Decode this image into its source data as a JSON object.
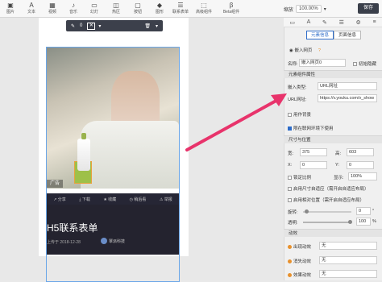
{
  "toolbar": {
    "items": [
      {
        "label": "图片",
        "icon": "image-icon",
        "glyph": "▣"
      },
      {
        "label": "文本",
        "icon": "text-icon",
        "glyph": "A"
      },
      {
        "label": "视频",
        "icon": "video-icon",
        "glyph": "▦"
      },
      {
        "label": "音乐",
        "icon": "music-icon",
        "glyph": "♪"
      },
      {
        "label": "幻灯",
        "icon": "slides-icon",
        "glyph": "▭"
      },
      {
        "label": "热区",
        "icon": "hotspot-icon",
        "glyph": "◫"
      },
      {
        "label": "按钮",
        "icon": "button-icon",
        "glyph": "▢"
      },
      {
        "label": "图形",
        "icon": "shape-icon",
        "glyph": "◆"
      },
      {
        "label": "联系表单",
        "icon": "form-icon",
        "glyph": "☰"
      },
      {
        "label": "高级组件",
        "icon": "advanced-icon",
        "glyph": "⬚"
      },
      {
        "label": "Beta组件",
        "icon": "beta-icon",
        "glyph": "β"
      }
    ],
    "zoom_label": "缩放",
    "zoom_value": "100.00%",
    "save_label": "保存"
  },
  "selbar": {
    "count": "0"
  },
  "preview": {
    "ad_tag": "广告",
    "actions": [
      "分享",
      "下载",
      "收藏",
      "稍后看",
      "举报"
    ],
    "title": "H5联系表单",
    "meta": "上传于 2018-12-28",
    "author": "覃派科技"
  },
  "panel": {
    "tabs": [
      "元素信息",
      "页面信息"
    ],
    "component_name": "嵌入网页",
    "name_label": "名称:",
    "name_value": "嵌入网页0",
    "lock_label": "初始隐藏",
    "section_props": "元素组件属性",
    "embed_type_label": "嵌入类型:",
    "embed_type_value": "URL网址",
    "url_label": "URL网址:",
    "url_value": "https://v.youku.com/v_show",
    "bg_label": "用作背景",
    "net_label": "限在联网环境下使用",
    "section_size": "尺寸与位置",
    "width_label": "宽:",
    "width_value": "375",
    "height_label": "高:",
    "height_value": "603",
    "x_label": "X:",
    "x_value": "0",
    "y_label": "Y:",
    "y_value": "0",
    "px": "px",
    "lock_ratio_label": "锁定比例",
    "display_label": "显示:",
    "display_value": "100%",
    "adaptive1_label": "启用尺寸自适应（需开启自适应布局）",
    "adaptive2_label": "启用相对位置（需开启自适应布局）",
    "rotate_label": "旋转:",
    "rotate_value": "0",
    "opacity_label": "透明:",
    "opacity_value": "100",
    "rotate_unit": "°",
    "opacity_unit": "%",
    "section_anim": "动效",
    "anim_in_label": "出现动效",
    "anim_in_value": "无",
    "anim_out_label": "消失动效",
    "anim_out_value": "无",
    "anim_fx_label": "效果动效",
    "anim_fx_value": "无"
  },
  "colors": {
    "arrow": "#e8336b",
    "accent": "#2d6cc9",
    "dark": "#24232f"
  }
}
